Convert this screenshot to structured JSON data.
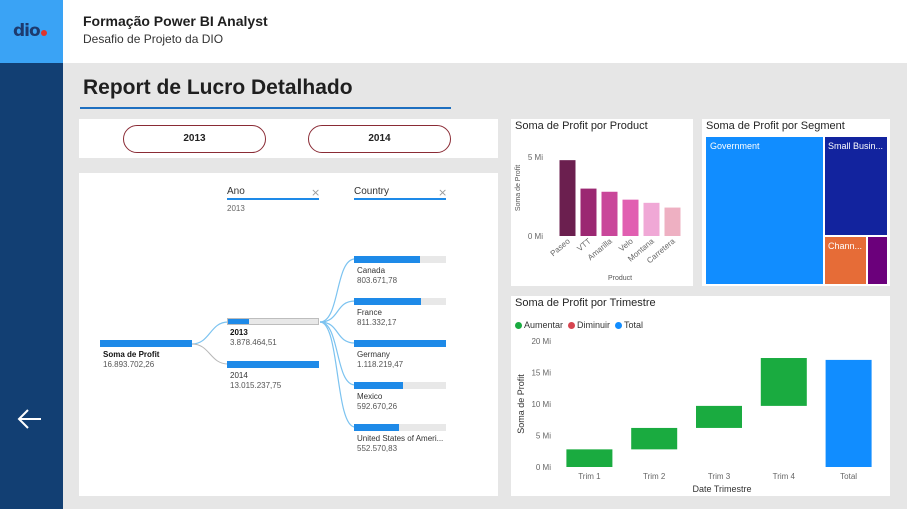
{
  "header": {
    "logo_text": "dio",
    "title": "Formação Power BI Analyst",
    "subtitle": "Desafio de Projeto da DIO"
  },
  "sidebar": {
    "back_icon": "arrow-left-icon"
  },
  "report": {
    "title": "Report de Lucro Detalhado"
  },
  "slicer": {
    "options": [
      "2013",
      "2014"
    ]
  },
  "decomp_tree": {
    "col_ano": "Ano",
    "col_ano_filter": "2013",
    "col_country": "Country",
    "root": {
      "label": "Soma de Profit",
      "value": "16.893.702,26",
      "share": 1.0
    },
    "years": [
      {
        "label": "2013",
        "value": "3.878.464,51",
        "share": 0.23
      },
      {
        "label": "2014",
        "value": "13.015.237,75",
        "share": 1.0
      }
    ],
    "countries": [
      {
        "label": "Canada",
        "value": "803.671,78",
        "share": 0.72
      },
      {
        "label": "France",
        "value": "811.332,17",
        "share": 0.73
      },
      {
        "label": "Germany",
        "value": "1.118.219,47",
        "share": 1.0
      },
      {
        "label": "Mexico",
        "value": "592.670,26",
        "share": 0.53
      },
      {
        "label": "United States of Ameri...",
        "value": "552.570,83",
        "share": 0.49
      }
    ]
  },
  "product_chart": {
    "title": "Soma de Profit por Product",
    "chart_data": {
      "type": "bar",
      "categories": [
        "Paseo",
        "VTT",
        "Amarilla",
        "Velo",
        "Montana",
        "Carretera"
      ],
      "values": [
        4.8,
        3.0,
        2.8,
        2.3,
        2.1,
        1.8
      ],
      "ylim": [
        0,
        5
      ],
      "y_ticks": [
        "0 Mi",
        "5 Mi"
      ],
      "xlabel": "Product",
      "ylabel": "Soma de Profit",
      "colors": [
        "#6b1f4f",
        "#9b2872",
        "#c9479a",
        "#e15fb1",
        "#f0a8d6",
        "#eeb0c2"
      ]
    }
  },
  "segment_chart": {
    "title": "Soma de Profit por Segment",
    "segments": [
      {
        "label": "Government",
        "color": "#118dff"
      },
      {
        "label": "Small Busin...",
        "color": "#12239e"
      },
      {
        "label": "Chann...",
        "color": "#e66c37"
      },
      {
        "label": "",
        "color": "#6b007b"
      }
    ]
  },
  "quarter_chart": {
    "title": "Soma de Profit por Trimestre",
    "legend": [
      {
        "label": "Aumentar",
        "color": "#1aab40"
      },
      {
        "label": "Diminuir",
        "color": "#d64550"
      },
      {
        "label": "Total",
        "color": "#118dff"
      }
    ],
    "chart_data": {
      "type": "bar",
      "subtype": "waterfall",
      "categories": [
        "Trim 1",
        "Trim 2",
        "Trim 3",
        "Trim 4",
        "Total"
      ],
      "values": [
        2.8,
        3.4,
        3.5,
        7.6,
        17.0
      ],
      "ylim": [
        0,
        20
      ],
      "y_ticks": [
        "0 Mi",
        "5 Mi",
        "10 Mi",
        "15 Mi",
        "20 Mi"
      ],
      "xlabel": "Date Trimestre",
      "ylabel": "Soma de Profit"
    }
  }
}
